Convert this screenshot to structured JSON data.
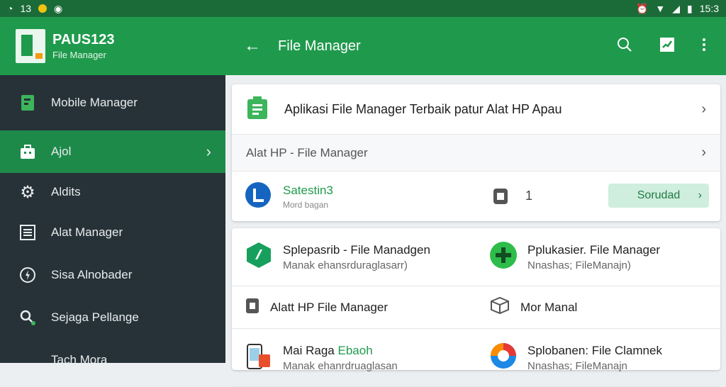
{
  "status": {
    "left_text": "13",
    "time": "15:3"
  },
  "drawer": {
    "title": "PAUS123",
    "subtitle": "File Manager",
    "items": [
      {
        "label": "Mobile Manager",
        "icon": "phone-icon"
      },
      {
        "label": "Ajol",
        "icon": "briefcase-icon"
      },
      {
        "label": "Aldits",
        "icon": "gear-icon"
      },
      {
        "label": "Alat Manager",
        "icon": "list-icon"
      },
      {
        "label": "Sisa Alnobader",
        "icon": "bolt-icon"
      },
      {
        "label": "Sejaga Pellange",
        "icon": "search-icon"
      },
      {
        "label": "Tach Mora",
        "icon": "tag-icon"
      }
    ]
  },
  "appbar": {
    "title": "File Manager"
  },
  "card1": {
    "row1": "Aplikasi File Manager Terbaik patur Alat HP Apau",
    "row2": "Alat HP - File Manager",
    "app": {
      "name": "Satestin3",
      "sub": "Mord bagan",
      "count": "1",
      "button": "Sorudad"
    }
  },
  "card2": {
    "items": [
      {
        "title": "Splepasrib - File Manadgen",
        "sub": "Manak ehansrduraglasarr)"
      },
      {
        "title": "Pplukasier. File Manager",
        "sub": "Nnashas; FileManajn)"
      },
      {
        "title": "Alatt HP File Manager",
        "sub": ""
      },
      {
        "title": "Mor Manal",
        "sub": ""
      },
      {
        "title": "Mai Raga",
        "title_green": "Ebaoh",
        "sub": "Manak ehanrdruaglasan"
      },
      {
        "title": "Splobanen: File Clamnek",
        "sub": "Nnashas; FileManajn"
      }
    ]
  }
}
